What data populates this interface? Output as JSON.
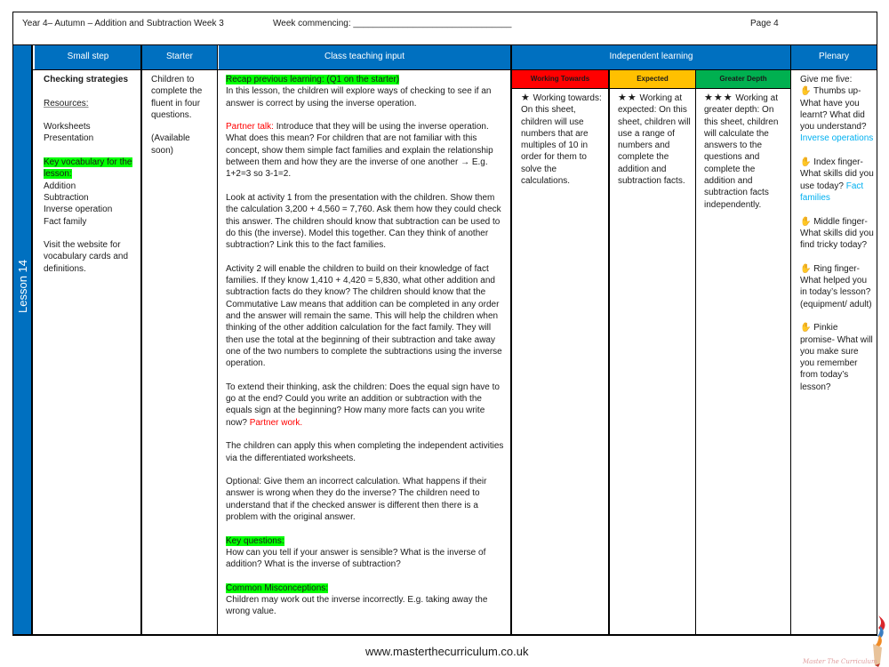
{
  "header": {
    "title": "Year 4– Autumn – Addition and Subtraction Week 3",
    "week_commencing": "Week commencing: ________________________________",
    "page": "Page 4"
  },
  "columns": {
    "small_step": "Small step",
    "starter": "Starter",
    "class_teaching": "Class teaching input",
    "independent": "Independent learning",
    "plenary": "Plenary"
  },
  "bands": {
    "working_towards": "Working Towards",
    "expected": "Expected",
    "greater_depth": "Greater Depth"
  },
  "colors": {
    "header_blue": "#0070c0",
    "highlight_green": "#00ff00",
    "working_towards": "#ff0000",
    "expected": "#ffc000",
    "greater_depth": "#00b050",
    "emphasis_red": "#ff0000",
    "answer_blue": "#00b0f0"
  },
  "lesson": {
    "label": "Lesson 14"
  },
  "small_step": {
    "title": "Checking strategies",
    "resources_label": "Resources:",
    "resources": [
      "Worksheets",
      "Presentation"
    ],
    "vocab_label_1": "Key vocabulary for the",
    "vocab_label_2": "lesson:",
    "vocab": [
      "Addition",
      "Subtraction",
      "Inverse operation",
      "Fact family"
    ],
    "website_note": "Visit the website for vocabulary cards and definitions."
  },
  "starter": {
    "text": "Children to complete the fluent in four questions.",
    "availability": "(Available soon)"
  },
  "teaching": {
    "recap_label": "Recap previous learning: (Q1 on the starter)",
    "intro": "In this lesson, the children will explore ways of checking to see if an answer is correct by using the inverse operation.",
    "partner_talk_label": "Partner talk:",
    "partner_talk": " Introduce that they will be using the inverse operation. What does this mean? For children that are not familiar with this concept, show them simple fact families and explain the relationship between them and how they are the inverse of one another → E.g. 1+2=3 so 3-1=2.",
    "activity1": "Look at activity 1 from the presentation with the children. Show them the calculation 3,200 + 4,560 = 7,760. Ask them how they could check this answer. The children should know that subtraction can be used to do this (the inverse). Model this together. Can they think of another subtraction? Link this to the fact families.",
    "activity2": "Activity 2 will enable the children to build on their knowledge of fact families. If they know 1,410 + 4,420 = 5,830, what other addition and subtraction facts do they know? The children should know that the Commutative Law means that addition can be completed in any order and the answer will remain the same. This will help the children when thinking of the other addition calculation for the fact family. They will then use the total at the beginning of their subtraction and take away one of the two numbers to complete the subtractions using the inverse operation.",
    "extend": "To extend their thinking, ask the children: Does the equal sign have to go at the end? Could you write an addition or subtraction with the equals sign at the beginning? How many more facts can you write now? ",
    "partner_work": "Partner work.",
    "apply": "The children can apply this when completing the independent activities via the differentiated worksheets.",
    "optional": "Optional: Give them an incorrect calculation. What happens if their answer is wrong when they do the inverse? The children need to understand that if the checked answer is different then there is a problem with the original answer.",
    "key_questions_label": "Key questions:",
    "key_questions": "How can you tell if your answer is sensible? What is the inverse of addition? What is the inverse of subtraction?",
    "misconceptions_label": "Common Misconceptions:",
    "misconceptions": "Children may work out the inverse incorrectly. E.g. taking away the wrong value."
  },
  "independent": {
    "working_towards": {
      "stars": "★",
      "text": " Working towards: On this sheet, children will use numbers that are multiples of 10 in order for them to solve the calculations."
    },
    "expected": {
      "stars": "★★",
      "text": " Working at expected: On this sheet, children will use a range of numbers and complete the addition and subtraction facts."
    },
    "greater_depth": {
      "stars": "★★★",
      "text": " Working at greater depth: On this sheet, children will calculate the answers to the questions and complete the addition and subtraction facts independently."
    }
  },
  "plenary": {
    "intro": "Give me five:",
    "items": [
      {
        "icon": "hand-icon",
        "text": " Thumbs up- What have you learnt? What did you understand? ",
        "answer": "Inverse operations"
      },
      {
        "icon": "hand-icon",
        "text": " Index finger- What skills did you use today? ",
        "answer": "Fact families"
      },
      {
        "icon": "hand-icon",
        "text": " Middle finger- What skills did you find tricky today?",
        "answer": ""
      },
      {
        "icon": "hand-icon",
        "text": " Ring finger- What helped you in today’s lesson? (equipment/ adult)",
        "answer": ""
      },
      {
        "icon": "hand-icon",
        "text": " Pinkie promise- What will you make sure you remember from today’s lesson?",
        "answer": ""
      }
    ]
  },
  "footer": {
    "url": "www.masterthecurriculum.co.uk",
    "logo_text": "Master The Curriculum"
  }
}
